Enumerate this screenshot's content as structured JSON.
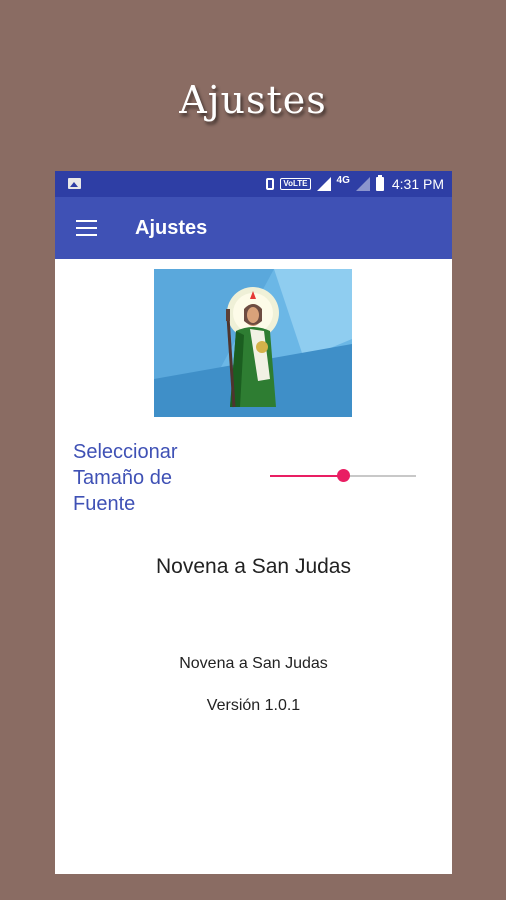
{
  "promo": {
    "title": "Ajustes"
  },
  "status_bar": {
    "volte": "VoLTE",
    "network": "4G",
    "time": "4:31 PM",
    "icons": [
      "gallery-icon",
      "vibrate-icon",
      "signal-icon",
      "battery-icon"
    ]
  },
  "app_bar": {
    "title": "Ajustes",
    "color": "#3f51b5",
    "status_color": "#2e3ea5"
  },
  "settings": {
    "font_size_label": "Seleccionar Tamaño de Fuente",
    "font_size_slider_value": 0.5,
    "accent_color": "#e91e63",
    "sample_text": "Novena a San Judas"
  },
  "about": {
    "app_name": "Novena a San Judas",
    "version": "Versión 1.0.1"
  },
  "image": {
    "name": "san-judas-tadeo-image"
  }
}
